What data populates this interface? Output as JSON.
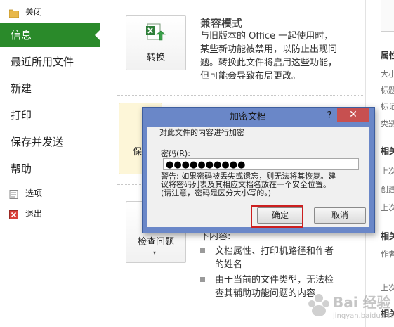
{
  "nav": {
    "close_label": "关闭",
    "info_label": "信息",
    "recent_label": "最近所用文件",
    "new_label": "新建",
    "print_label": "打印",
    "save_send_label": "保存并发送",
    "help_label": "帮助",
    "options_label": "选项",
    "exit_label": "退出"
  },
  "main": {
    "convert_label": "转换",
    "compat_title": "兼容模式",
    "compat_desc": [
      "与旧版本的 Office 一起使用时，",
      "某些新功能被禁用，以防止出现问",
      "题。转换此文件将启用这些功能，",
      "但可能会导致布局更改。"
    ],
    "protect_partial": "保",
    "inspect_label": "检查问题",
    "inspect_caption_partial": "下内容:",
    "bullets": [
      [
        "文档属性、打印机路径和作者",
        "的姓名"
      ],
      [
        "由于当前的文件类型，无法检",
        "查其辅助功能问题的内容"
      ]
    ]
  },
  "right_panel": {
    "items": [
      "属性",
      "大小",
      "标题",
      "标记",
      "类别",
      "相关",
      "上次",
      "创建",
      "上次",
      "相关",
      "作者",
      "上次",
      "相关"
    ]
  },
  "dialog": {
    "title": "加密文档",
    "help": "?",
    "close": "✕",
    "group_label": "对此文件的内容进行加密",
    "password_label": "密码(R):",
    "password_value": "●●●●●●●●●●",
    "warning_lines": [
      "警告: 如果密码被丢失或遗忘，则无法将其恢复。建",
      "议将密码列表及其相应文档名放在一个安全位置。",
      "(请注意，密码是区分大小写的。)"
    ],
    "ok_label": "确定",
    "cancel_label": "取消"
  },
  "watermark": {
    "text": "Bai 经验",
    "sub": "jingyan.baidu.com"
  },
  "colors": {
    "nav_active": "#2a8a2a",
    "dialog_frame": "#6a87c8",
    "close_button": "#c75050",
    "highlight_box": "#cc1f1f"
  }
}
